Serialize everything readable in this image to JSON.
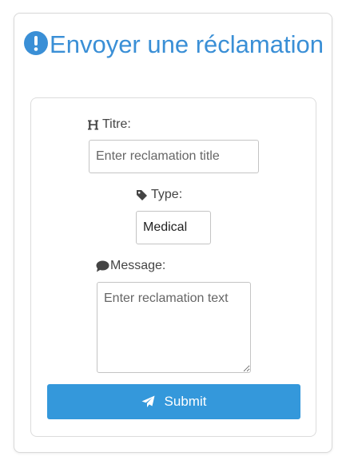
{
  "page": {
    "title": "Envoyer une réclamation",
    "title_icon": "exclamation-circle-icon",
    "accent_color": "#3a8fd6"
  },
  "form": {
    "titre": {
      "label": "Titre:",
      "icon": "heading-icon",
      "placeholder": "Enter reclamation title",
      "value": ""
    },
    "type": {
      "label": "Type:",
      "icon": "tag-icon",
      "value": "Medical"
    },
    "message": {
      "label": "Message:",
      "icon": "comment-icon",
      "placeholder": "Enter reclamation text",
      "value": ""
    },
    "submit": {
      "label": "Submit",
      "icon": "paper-plane-icon",
      "color": "#3498db"
    }
  }
}
